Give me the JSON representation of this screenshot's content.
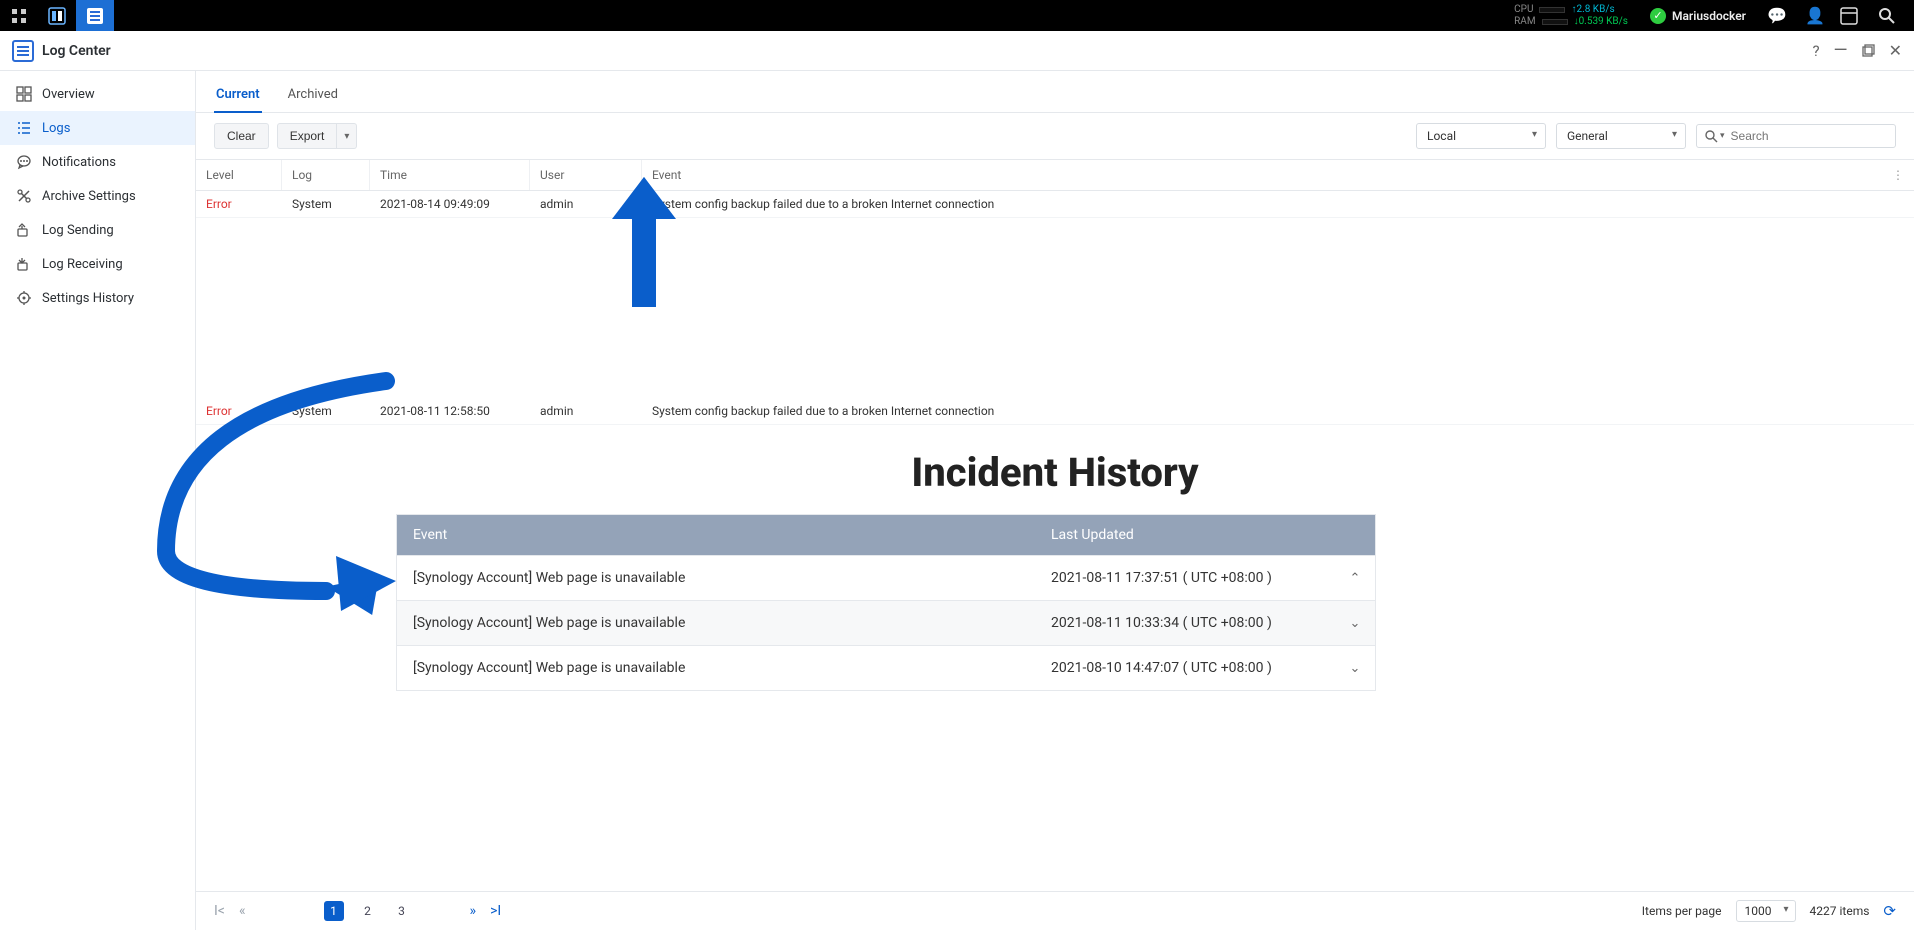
{
  "taskbar": {
    "cpu_label": "CPU",
    "ram_label": "RAM",
    "rate_up": "2.8 KB/s",
    "rate_down": "0.539 KB/s",
    "username": "Mariusdocker"
  },
  "window": {
    "title": "Log Center"
  },
  "sidebar": {
    "items": [
      {
        "label": "Overview"
      },
      {
        "label": "Logs"
      },
      {
        "label": "Notifications"
      },
      {
        "label": "Archive Settings"
      },
      {
        "label": "Log Sending"
      },
      {
        "label": "Log Receiving"
      },
      {
        "label": "Settings History"
      }
    ]
  },
  "tabs": {
    "current": "Current",
    "archived": "Archived"
  },
  "toolbar": {
    "clear": "Clear",
    "export": "Export",
    "scope": "Local",
    "category": "General",
    "search_placeholder": "Search"
  },
  "grid": {
    "headers": {
      "level": "Level",
      "log": "Log",
      "time": "Time",
      "user": "User",
      "event": "Event"
    },
    "rows": [
      {
        "level": "Error",
        "log": "System",
        "time": "2021-08-14 09:49:09",
        "user": "admin",
        "event": "System config backup failed due to a broken Internet connection"
      },
      {
        "level": "Error",
        "log": "System",
        "time": "2021-08-11 12:58:50",
        "user": "admin",
        "event": "System config backup failed due to a broken Internet connection"
      }
    ]
  },
  "incident": {
    "title": "Incident History",
    "headers": {
      "event": "Event",
      "updated": "Last Updated"
    },
    "rows": [
      {
        "event": "[Synology Account] Web page is unavailable",
        "updated": "2021-08-11 17:37:51 ( UTC +08:00 )",
        "expanded": true
      },
      {
        "event": "[Synology Account] Web page is unavailable",
        "updated": "2021-08-11 10:33:34 ( UTC +08:00 )",
        "expanded": false
      },
      {
        "event": "[Synology Account] Web page is unavailable",
        "updated": "2021-08-10 14:47:07 ( UTC +08:00 )",
        "expanded": false
      }
    ]
  },
  "pager": {
    "pages": [
      "1",
      "2",
      "3"
    ],
    "items_per_page_label": "Items per page",
    "items_per_page": "1000",
    "total": "4227 items"
  }
}
